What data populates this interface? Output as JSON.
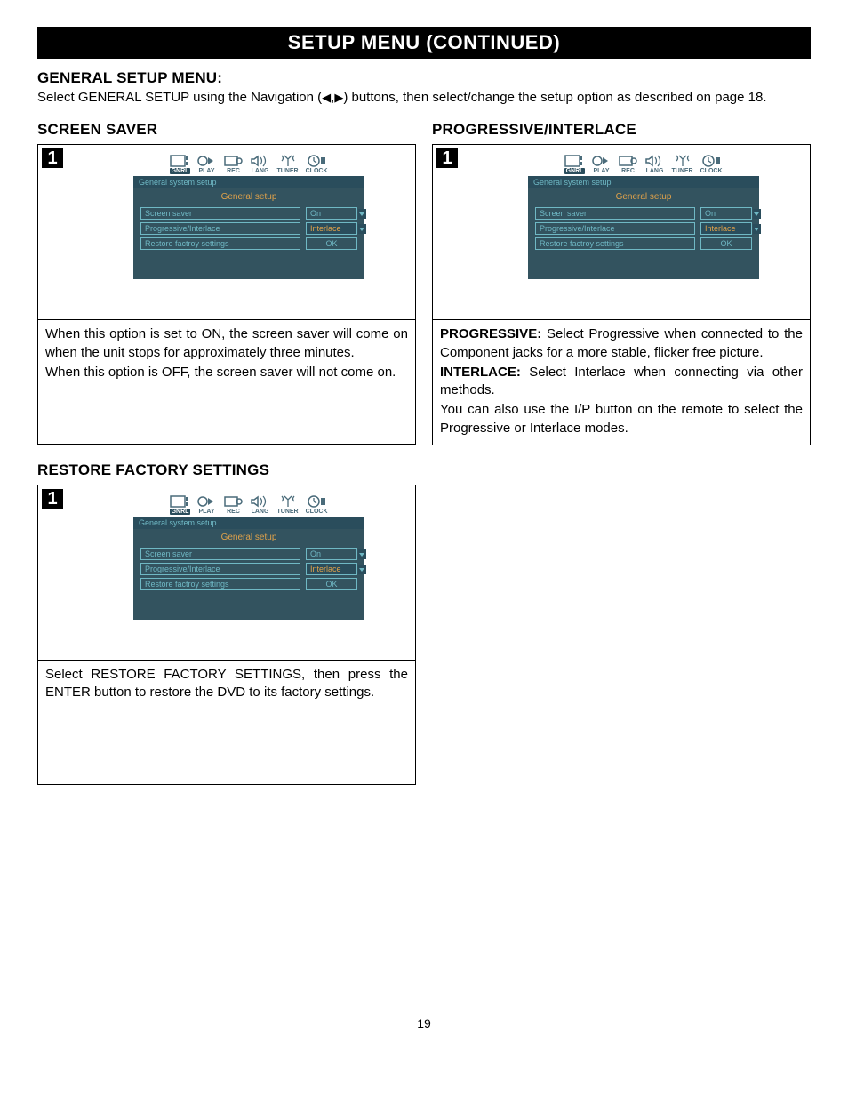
{
  "titleBar": "SETUP MENU (CONTINUED)",
  "generalHeading": "GENERAL SETUP MENU:",
  "intro_a": "Select GENERAL SETUP using the Navigation (",
  "intro_b": ") buttons, then select/change the setup option as described on page 18.",
  "arrowLeft": "◀",
  "arrowSep": ",",
  "arrowRight": "▶",
  "sections": {
    "screenSaver": {
      "heading": "SCREEN SAVER",
      "step": "1",
      "desc_a": "When this option is set to ON, the screen saver will come on when the unit stops for approximately three minutes.",
      "desc_b": "When this option is OFF, the screen saver will not come on."
    },
    "progressive": {
      "heading": "PROGRESSIVE/INTERLACE",
      "step": "1",
      "prog_label": "PROGRESSIVE:",
      "prog_text": " Select Progressive when connected to the Component jacks for a more stable, flicker free picture.",
      "int_label": "INTERLACE:",
      "int_text": " Select Interlace when connecting via other methods.",
      "note": "You can also use the I/P button on the remote to select the Progressive or Interlace modes."
    },
    "restore": {
      "heading": "RESTORE FACTORY SETTINGS",
      "step": "1",
      "desc": "Select RESTORE FACTORY SETTINGS, then press the ENTER button to restore the DVD to its factory settings."
    }
  },
  "osd": {
    "tabs": [
      "GNRL",
      "PLAY",
      "REC",
      "LANG",
      "TUNER",
      "CLOCK"
    ],
    "strip": "General system setup",
    "title": "General setup",
    "rows": {
      "r1_label": "Screen saver",
      "r1_val": "On",
      "r2_label": "Progressive/Interlace",
      "r2_val": "Interlace",
      "r3_label": "Restore factroy settings",
      "r3_val": "OK"
    }
  },
  "pageNumber": "19"
}
